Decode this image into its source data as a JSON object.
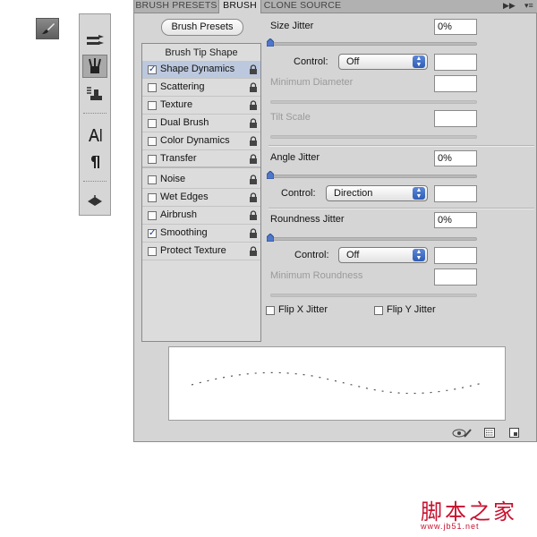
{
  "tabs": [
    {
      "label": "BRUSH PRESETS",
      "active": false
    },
    {
      "label": "BRUSH",
      "active": true
    },
    {
      "label": "CLONE SOURCE",
      "active": false
    }
  ],
  "panel_menu_icon": "double-arrow-icon",
  "brush_presets_button": "Brush Presets",
  "tip_header": "Brush Tip Shape",
  "options": [
    {
      "label": "Shape Dynamics",
      "checked": true,
      "selected": true
    },
    {
      "label": "Scattering",
      "checked": false
    },
    {
      "label": "Texture",
      "checked": false
    },
    {
      "label": "Dual Brush",
      "checked": false
    },
    {
      "label": "Color Dynamics",
      "checked": false
    },
    {
      "label": "Transfer",
      "checked": false
    },
    {
      "label": "Noise",
      "checked": false
    },
    {
      "label": "Wet Edges",
      "checked": false
    },
    {
      "label": "Airbrush",
      "checked": false
    },
    {
      "label": "Smoothing",
      "checked": true
    },
    {
      "label": "Protect Texture",
      "checked": false
    }
  ],
  "size_jitter": {
    "label": "Size Jitter",
    "value": "0%",
    "slider": 0
  },
  "size_control": {
    "label": "Control:",
    "selected": "Off",
    "value": ""
  },
  "min_diameter": {
    "label": "Minimum Diameter",
    "value": ""
  },
  "tilt_scale": {
    "label": "Tilt Scale",
    "value": ""
  },
  "angle_jitter": {
    "label": "Angle Jitter",
    "value": "0%",
    "slider": 0
  },
  "angle_control": {
    "label": "Control:",
    "selected": "Direction",
    "value": ""
  },
  "roundness_jitter": {
    "label": "Roundness Jitter",
    "value": "0%",
    "slider": 0
  },
  "roundness_control": {
    "label": "Control:",
    "selected": "Off",
    "value": ""
  },
  "min_roundness": {
    "label": "Minimum Roundness",
    "value": ""
  },
  "flip_x": {
    "label": "Flip X Jitter",
    "checked": false
  },
  "flip_y": {
    "label": "Flip Y Jitter",
    "checked": false
  },
  "footer_icons": [
    "eye-brush-icon",
    "grid-icon",
    "new-preset-icon"
  ],
  "toolbar_icons": [
    "brush-tool-icon",
    "brush-panel-icon",
    "presets-icon",
    "clone-source-icon",
    "character-icon",
    "paragraph-icon",
    "layer-comps-icon"
  ],
  "watermark": {
    "text": "脚本之家",
    "url": "www.jb51.net"
  },
  "colors": {
    "panel": "#d5d5d5",
    "tab_bar": "#b1b1b1",
    "selected_row": "#bcc8de",
    "select_arrow": "#2f5cb6",
    "watermark": "#c8102e"
  }
}
